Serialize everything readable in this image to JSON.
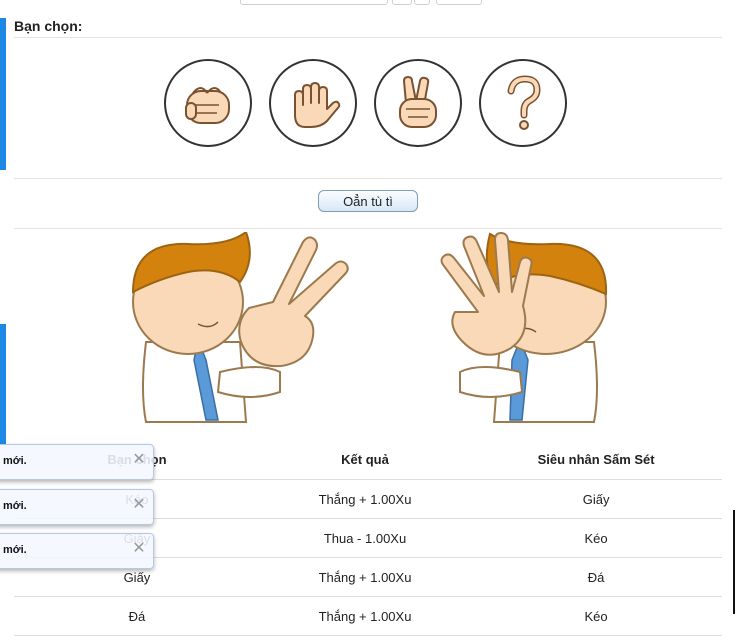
{
  "title": "Bạn chọn:",
  "choices": [
    {
      "name": "Đá",
      "icon": "rock-hand-icon"
    },
    {
      "name": "Giấy",
      "icon": "paper-hand-icon"
    },
    {
      "name": "Kéo",
      "icon": "scissors-hand-icon"
    },
    {
      "name": "Ngẫu nhiên",
      "icon": "question-mark-icon"
    }
  ],
  "play_button": "Oẳn tù tì",
  "table": {
    "headers": [
      "Bạn chọn",
      "Kết quả",
      "Siêu nhân Sấm Sét"
    ],
    "rows": [
      [
        "Kéo",
        "Thắng + 1.00Xu",
        "Giấy"
      ],
      [
        "Giấy",
        "Thua - 1.00Xu",
        "Kéo"
      ],
      [
        "Giấy",
        "Thắng + 1.00Xu",
        "Đá"
      ],
      [
        "Đá",
        "Thắng + 1.00Xu",
        "Kéo"
      ]
    ]
  },
  "toasts": [
    {
      "text": "mới.",
      "close": "✕"
    },
    {
      "text": "mới.",
      "close": "✕"
    },
    {
      "text": "mới.",
      "close": "✕"
    }
  ],
  "colors": {
    "accent": "#1e88e5",
    "skin": "#f9d9b8",
    "hair": "#d4820e",
    "tie": "#5a9ad8"
  }
}
